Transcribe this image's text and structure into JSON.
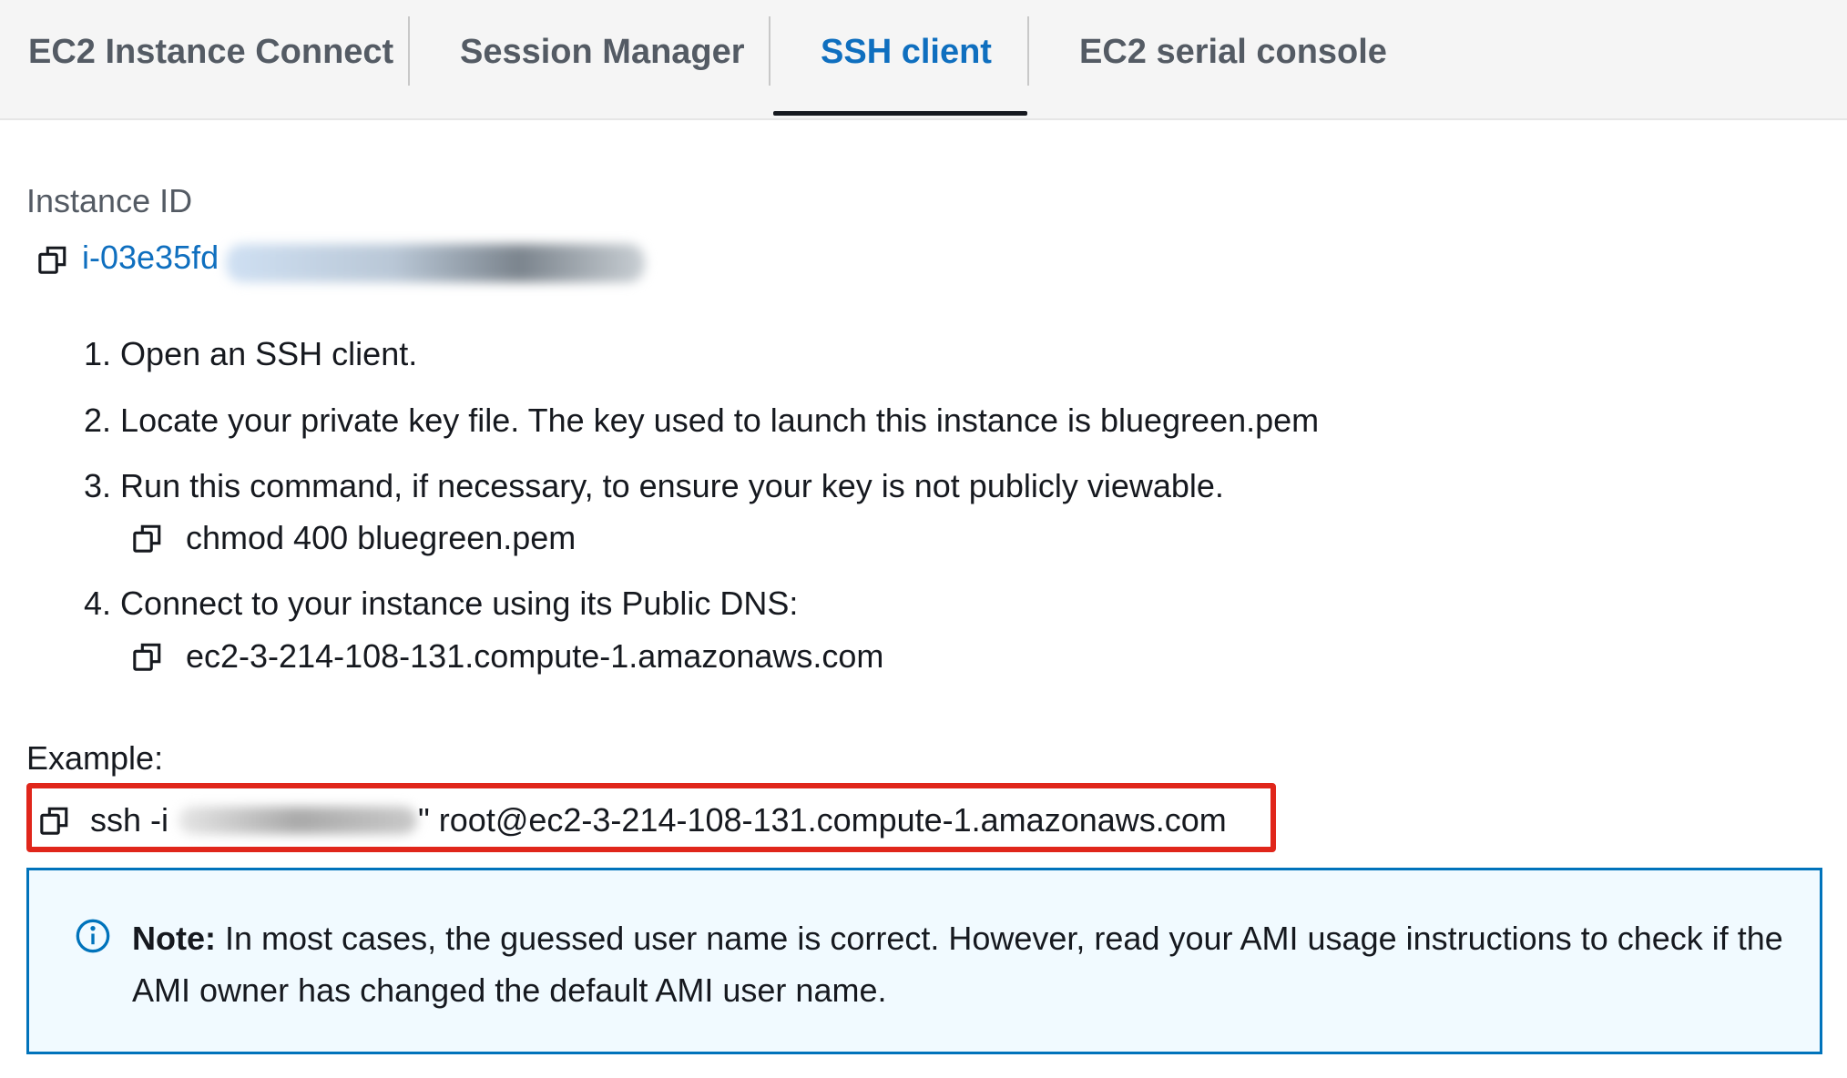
{
  "tabs": [
    {
      "label": "EC2 Instance Connect",
      "active": false
    },
    {
      "label": "Session Manager",
      "active": false
    },
    {
      "label": "SSH client",
      "active": true
    },
    {
      "label": "EC2 serial console",
      "active": false
    }
  ],
  "instance": {
    "label": "Instance ID",
    "id_visible": "i-03e35fd"
  },
  "steps": [
    {
      "number": "1.",
      "text": "Open an SSH client."
    },
    {
      "number": "2.",
      "text": "Locate your private key file. The key used to launch this instance is bluegreen.pem"
    },
    {
      "number": "3.",
      "text": "Run this command, if necessary, to ensure your key is not publicly viewable."
    },
    {
      "number": "4.",
      "text": "Connect to your instance using its Public DNS:"
    }
  ],
  "commands": {
    "chmod": "chmod 400 bluegreen.pem",
    "public_dns": "ec2-3-214-108-131.compute-1.amazonaws.com"
  },
  "example": {
    "label": "Example:",
    "ssh_prefix": "ssh -i",
    "ssh_suffix": "\" root@ec2-3-214-108-131.compute-1.amazonaws.com"
  },
  "note": {
    "bold": "Note:",
    "text": " In most cases, the guessed user name is correct. However, read your AMI usage instructions to check if the AMI owner has changed the default AMI user name."
  },
  "colors": {
    "link": "#0f6fbf",
    "highlight_border": "#e0261b",
    "info_border": "#0073bb",
    "info_bg": "#f1faff"
  },
  "icons": [
    "copy-icon",
    "info-icon"
  ]
}
